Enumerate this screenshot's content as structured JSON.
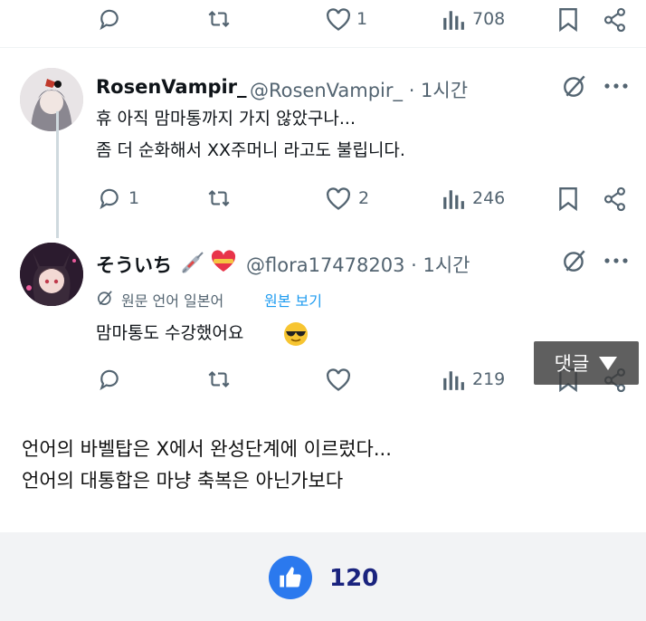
{
  "top_actions": {
    "reply_count": "",
    "retweet_count": "",
    "like_count": "1",
    "views": "708"
  },
  "tweet1": {
    "name": "RosenVampir_",
    "handle": "@RosenVampir_ · 1시간",
    "line1": "휴 아직 맘마통까지 가지 않았구나...",
    "line2": "좀 더 순화해서 XX주머니 라고도 불립니다.",
    "reply_count": "1",
    "like_count": "2",
    "views": "246"
  },
  "tweet2": {
    "name": "そういち",
    "handle": "@flora17478203 · 1시간",
    "translated_note": "원문 언어 일본어",
    "show_original": "원본 보기",
    "text": "맘마통도 수강했어요",
    "views": "219"
  },
  "comment_button": "댓글",
  "caption": {
    "line1": "언어의 바벨탑은 X에서 완성단계에 이르렀다...",
    "line2": "언어의 대통합은 마냥 축복은 아닌가보다"
  },
  "like_total": "120",
  "colors": {
    "accent": "#2b79ee",
    "icon_gray": "#536471",
    "link": "#1d9bf0"
  }
}
